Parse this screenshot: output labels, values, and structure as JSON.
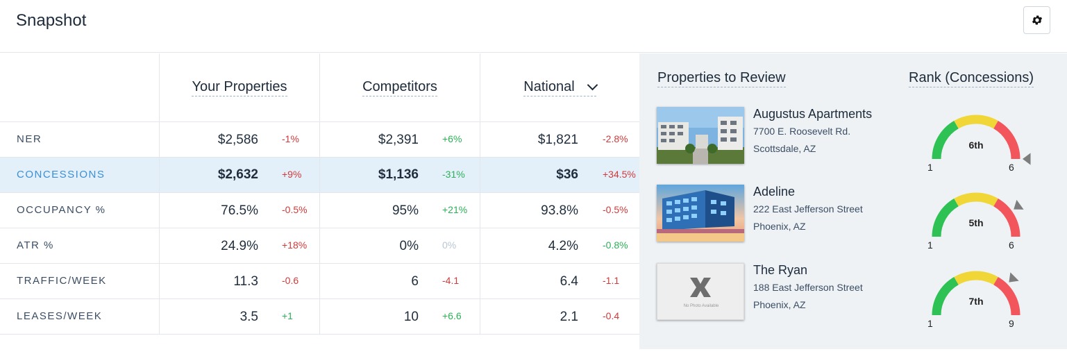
{
  "header": {
    "title": "Snapshot",
    "settings_icon": "gear-icon"
  },
  "columns": [
    {
      "label": "Your Properties"
    },
    {
      "label": "Competitors"
    },
    {
      "label": "National",
      "dropdown_icon": "chevron-down-icon"
    }
  ],
  "rows": [
    {
      "label": "NER",
      "highlighted": false,
      "cells": [
        {
          "value": "$2,586",
          "delta": "-1%",
          "tone": "neg"
        },
        {
          "value": "$2,391",
          "delta": "+6%",
          "tone": "pos"
        },
        {
          "value": "$1,821",
          "delta": "-2.8%",
          "tone": "neg"
        }
      ]
    },
    {
      "label": "CONCESSIONS",
      "highlighted": true,
      "cells": [
        {
          "value": "$2,632",
          "delta": "+9%",
          "tone": "neg"
        },
        {
          "value": "$1,136",
          "delta": "-31%",
          "tone": "pos"
        },
        {
          "value": "$36",
          "delta": "+34.5%",
          "tone": "neg"
        }
      ]
    },
    {
      "label": "OCCUPANCY %",
      "highlighted": false,
      "cells": [
        {
          "value": "76.5%",
          "delta": "-0.5%",
          "tone": "neg"
        },
        {
          "value": "95%",
          "delta": "+21%",
          "tone": "pos"
        },
        {
          "value": "93.8%",
          "delta": "-0.5%",
          "tone": "neg"
        }
      ]
    },
    {
      "label": "ATR %",
      "highlighted": false,
      "cells": [
        {
          "value": "24.9%",
          "delta": "+18%",
          "tone": "neg"
        },
        {
          "value": "0%",
          "delta": "0%",
          "tone": "neu"
        },
        {
          "value": "4.2%",
          "delta": "-0.8%",
          "tone": "pos"
        }
      ]
    },
    {
      "label": "TRAFFIC/WEEK",
      "highlighted": false,
      "cells": [
        {
          "value": "11.3",
          "delta": "-0.6",
          "tone": "neg"
        },
        {
          "value": "6",
          "delta": "-4.1",
          "tone": "neg"
        },
        {
          "value": "6.4",
          "delta": "-1.1",
          "tone": "neg"
        }
      ]
    },
    {
      "label": "LEASES/WEEK",
      "highlighted": false,
      "cells": [
        {
          "value": "3.5",
          "delta": "+1",
          "tone": "pos"
        },
        {
          "value": "10",
          "delta": "+6.6",
          "tone": "pos"
        },
        {
          "value": "2.1",
          "delta": "-0.4",
          "tone": "neg"
        }
      ]
    }
  ],
  "review": {
    "title": "Properties to Review",
    "rank_title": "Rank (Concessions)",
    "properties": [
      {
        "name": "Augustus Apartments",
        "address1": "7700 E. Roosevelt Rd.",
        "address2": "Scottsdale, AZ",
        "image": "building-photo",
        "rank_label": "6th",
        "rank": 6,
        "min": "1",
        "max": "6",
        "total": 6
      },
      {
        "name": "Adeline",
        "address1": "222 East Jefferson Street",
        "address2": "Phoenix, AZ",
        "image": "building-photo",
        "rank_label": "5th",
        "rank": 5,
        "min": "1",
        "max": "6",
        "total": 6
      },
      {
        "name": "The Ryan",
        "address1": "188 East Jefferson Street",
        "address2": "Phoenix, AZ",
        "image": "no-photo-placeholder",
        "no_photo_text": "No Photo Available",
        "rank_label": "7th",
        "rank": 7,
        "min": "1",
        "max": "9",
        "total": 9
      }
    ]
  },
  "colors": {
    "negative": "#d1393a",
    "positive": "#2bb056",
    "neutral": "#b9c6d4",
    "highlight_row": "#e3f0fa",
    "gauge_green": "#2ec254",
    "gauge_yellow": "#f0d737",
    "gauge_red": "#f2555b"
  }
}
